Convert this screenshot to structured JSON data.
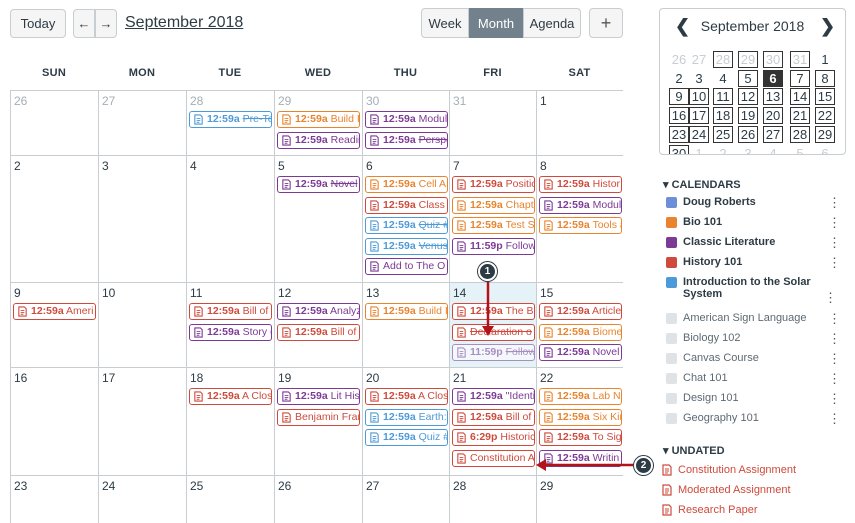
{
  "toolbar": {
    "today": "Today",
    "prev_icon": "←",
    "next_icon": "→",
    "title": "September 2018",
    "views": [
      "Week",
      "Month",
      "Agenda"
    ],
    "add_icon": "+"
  },
  "dow": [
    "SUN",
    "MON",
    "TUE",
    "WED",
    "THU",
    "FRI",
    "SAT"
  ],
  "weeks": [
    [
      {
        "d": "26",
        "out": true,
        "ev": []
      },
      {
        "d": "27",
        "out": true,
        "ev": []
      },
      {
        "d": "28",
        "out": true,
        "ev": [
          {
            "c": "c-sol",
            "t": "12:59a",
            "x": "Pre-Te",
            "s": true
          }
        ]
      },
      {
        "d": "29",
        "out": true,
        "ev": [
          {
            "c": "c-bio",
            "t": "12:59a",
            "x": "Build I"
          },
          {
            "c": "c-lit",
            "t": "12:59a",
            "x": "Readin"
          }
        ]
      },
      {
        "d": "30",
        "out": true,
        "ev": [
          {
            "c": "c-lit",
            "t": "12:59a",
            "x": "Modul"
          },
          {
            "c": "c-lit",
            "t": "12:59a",
            "x": "Perspe",
            "s": true
          }
        ]
      },
      {
        "d": "31",
        "out": true,
        "ev": []
      },
      {
        "d": "1",
        "ev": []
      }
    ],
    [
      {
        "d": "2",
        "ev": []
      },
      {
        "d": "3",
        "ev": []
      },
      {
        "d": "4",
        "ev": []
      },
      {
        "d": "5",
        "ev": [
          {
            "c": "c-lit",
            "t": "12:59a",
            "x": "Novel",
            "s": true
          }
        ]
      },
      {
        "d": "6",
        "ev": [
          {
            "c": "c-bio",
            "t": "12:59a",
            "x": "Cell A"
          },
          {
            "c": "c-hist",
            "t": "12:59a",
            "x": "Class F"
          },
          {
            "c": "c-sol",
            "t": "12:59a",
            "x": "Quiz #",
            "s": true
          },
          {
            "c": "c-sol",
            "t": "12:59a",
            "x": "Venus:",
            "s": true
          },
          {
            "c": "c-lit",
            "t": "",
            "x": "Add to The O"
          }
        ]
      },
      {
        "d": "7",
        "ev": [
          {
            "c": "c-hist",
            "t": "12:59a",
            "x": "Positic"
          },
          {
            "c": "c-bio",
            "t": "12:59a",
            "x": "Chapte"
          },
          {
            "c": "c-bio",
            "t": "12:59a",
            "x": "Test Su"
          },
          {
            "c": "c-lit",
            "t": "11:59p",
            "x": "Follow"
          }
        ]
      },
      {
        "d": "8",
        "ev": [
          {
            "c": "c-hist",
            "t": "12:59a",
            "x": "Histor"
          },
          {
            "c": "c-lit",
            "t": "12:59a",
            "x": "Modul"
          },
          {
            "c": "c-bio",
            "t": "12:59a",
            "x": "Tools a"
          }
        ]
      }
    ],
    [
      {
        "d": "9",
        "ev": [
          {
            "c": "c-hist",
            "t": "12:59a",
            "x": "Ameri"
          }
        ]
      },
      {
        "d": "10",
        "ev": []
      },
      {
        "d": "11",
        "ev": [
          {
            "c": "c-hist",
            "t": "12:59a",
            "x": "Bill of"
          },
          {
            "c": "c-lit",
            "t": "12:59a",
            "x": "Story ("
          }
        ]
      },
      {
        "d": "12",
        "ev": [
          {
            "c": "c-lit",
            "t": "12:59a",
            "x": "Analyz"
          },
          {
            "c": "c-hist",
            "t": "12:59a",
            "x": "Bill of"
          }
        ]
      },
      {
        "d": "13",
        "ev": [
          {
            "c": "c-bio",
            "t": "12:59a",
            "x": "Build I"
          }
        ]
      },
      {
        "d": "14",
        "today": true,
        "ev": [
          {
            "c": "c-hist",
            "t": "12:59a",
            "x": "The Bi"
          },
          {
            "c": "c-hist",
            "t": "",
            "x": "Declaration o",
            "s": true
          },
          {
            "c": "c-lit dim",
            "t": "11:59p",
            "x": "Follow",
            "s": true
          }
        ]
      },
      {
        "d": "15",
        "ev": [
          {
            "c": "c-hist",
            "t": "12:59a",
            "x": "Article"
          },
          {
            "c": "c-bio",
            "t": "12:59a",
            "x": "Biome"
          },
          {
            "c": "c-lit",
            "t": "12:59a",
            "x": "Novel"
          }
        ]
      }
    ],
    [
      {
        "d": "16",
        "ev": []
      },
      {
        "d": "17",
        "ev": []
      },
      {
        "d": "18",
        "ev": [
          {
            "c": "c-hist",
            "t": "12:59a",
            "x": "A Clos"
          }
        ]
      },
      {
        "d": "19",
        "ev": [
          {
            "c": "c-lit",
            "t": "12:59a",
            "x": "Lit His"
          },
          {
            "c": "c-hist",
            "t": "",
            "x": "Benjamin Frar"
          }
        ]
      },
      {
        "d": "20",
        "ev": [
          {
            "c": "c-hist",
            "t": "12:59a",
            "x": "A Clos"
          },
          {
            "c": "c-sol",
            "t": "12:59a",
            "x": "Earth:"
          },
          {
            "c": "c-sol",
            "t": "12:59a",
            "x": "Quiz #"
          }
        ]
      },
      {
        "d": "21",
        "ev": [
          {
            "c": "c-lit",
            "t": "12:59a",
            "x": "\"Identi"
          },
          {
            "c": "c-hist",
            "t": "12:59a",
            "x": "Bill of"
          },
          {
            "c": "c-hist",
            "t": "6:29p",
            "x": "Historic"
          },
          {
            "c": "c-hist",
            "t": "",
            "x": "Constitution A"
          }
        ]
      },
      {
        "d": "22",
        "ev": [
          {
            "c": "c-bio",
            "t": "12:59a",
            "x": "Lab No"
          },
          {
            "c": "c-bio",
            "t": "12:59a",
            "x": "Six Kir"
          },
          {
            "c": "c-hist",
            "t": "12:59a",
            "x": "To Sign"
          },
          {
            "c": "c-lit",
            "t": "12:59a",
            "x": "Writin"
          }
        ]
      }
    ],
    [
      {
        "d": "23",
        "ev": []
      },
      {
        "d": "24",
        "ev": []
      },
      {
        "d": "25",
        "ev": []
      },
      {
        "d": "26",
        "ev": []
      },
      {
        "d": "27",
        "ev": []
      },
      {
        "d": "28",
        "ev": []
      },
      {
        "d": "29",
        "ev": []
      }
    ]
  ],
  "mini": {
    "title": "September 2018",
    "prev_icon": "❮",
    "next_icon": "❯",
    "rows": [
      [
        "26",
        "27",
        "28",
        "29",
        "30",
        "31",
        "1"
      ],
      [
        "2",
        "3",
        "4",
        "5",
        "6",
        "7",
        "8"
      ],
      [
        "9",
        "10",
        "11",
        "12",
        "13",
        "14",
        "15"
      ],
      [
        "16",
        "17",
        "18",
        "19",
        "20",
        "21",
        "22"
      ],
      [
        "23",
        "24",
        "25",
        "26",
        "27",
        "28",
        "29"
      ],
      [
        "30",
        "1",
        "2",
        "3",
        "4",
        "5",
        "6"
      ]
    ]
  },
  "calendars": {
    "header": "CALENDARS",
    "active": [
      {
        "name": "Doug Roberts",
        "color": "#6d8fd8"
      },
      {
        "name": "Bio 101",
        "color": "#e8842d"
      },
      {
        "name": "Classic Literature",
        "color": "#7c3a96"
      },
      {
        "name": "History 101",
        "color": "#cf4a3c"
      },
      {
        "name": "Introduction to the Solar System",
        "color": "#4d9ad8"
      }
    ],
    "inactive": [
      "American Sign Language",
      "Biology 102",
      "Canvas Course",
      "Chat 101",
      "Design 101",
      "Geography 101"
    ],
    "kebab": "⋮"
  },
  "undated": {
    "header": "UNDATED",
    "items": [
      "Constitution Assignment",
      "Moderated Assignment",
      "Research Paper"
    ]
  },
  "callouts": [
    "1",
    "2"
  ],
  "colors": {
    "accent": "#cf4a3c",
    "month_active": "#73818c"
  }
}
